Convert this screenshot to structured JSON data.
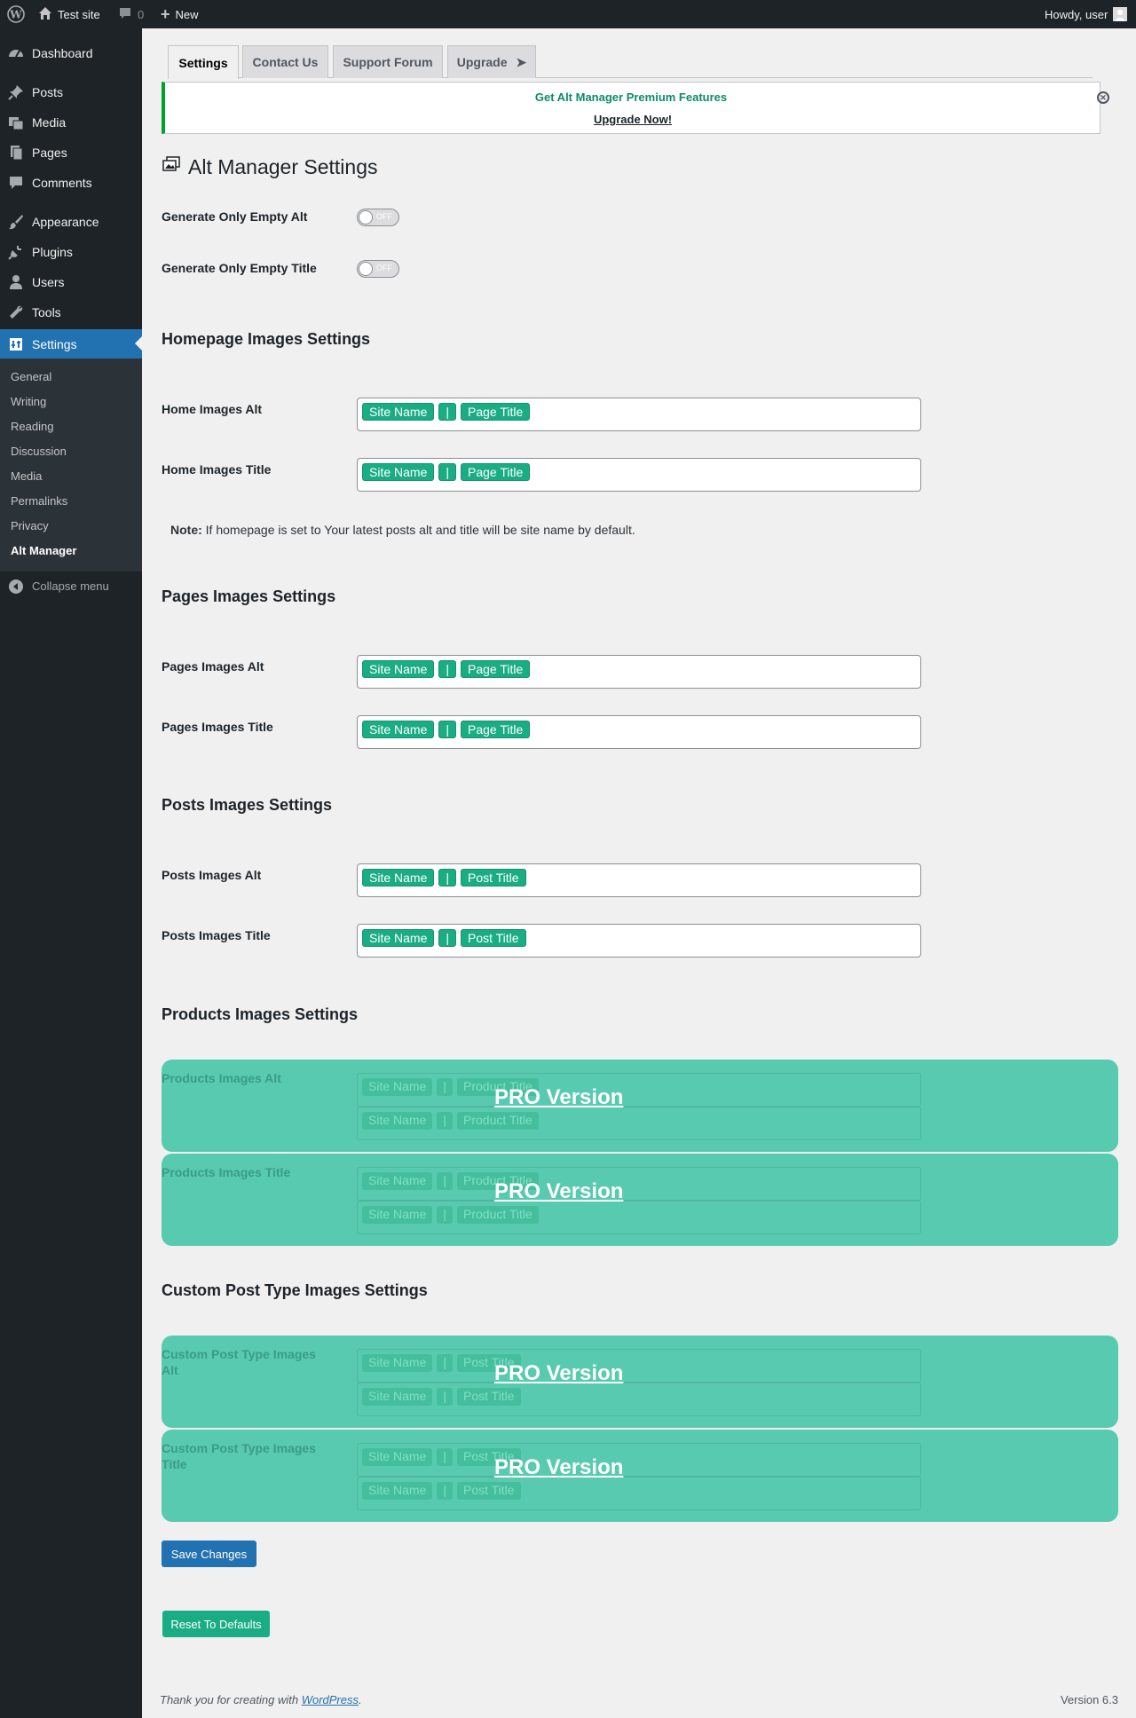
{
  "adminbar": {
    "site_name": "Test site",
    "comments_count": "0",
    "new_label": "New",
    "howdy": "Howdy, user"
  },
  "sidebar": {
    "items": [
      {
        "label": "Dashboard",
        "icon": "dashboard-icon"
      },
      {
        "label": "Posts",
        "icon": "pin-icon"
      },
      {
        "label": "Media",
        "icon": "media-icon"
      },
      {
        "label": "Pages",
        "icon": "pages-icon"
      },
      {
        "label": "Comments",
        "icon": "comment-icon"
      },
      {
        "label": "Appearance",
        "icon": "brush-icon"
      },
      {
        "label": "Plugins",
        "icon": "plug-icon"
      },
      {
        "label": "Users",
        "icon": "user-icon"
      },
      {
        "label": "Tools",
        "icon": "wrench-icon"
      },
      {
        "label": "Settings",
        "icon": "settings-icon"
      }
    ],
    "submenu": [
      "General",
      "Writing",
      "Reading",
      "Discussion",
      "Media",
      "Permalinks",
      "Privacy",
      "Alt Manager"
    ],
    "collapse": "Collapse menu"
  },
  "tabs": [
    "Settings",
    "Contact Us",
    "Support Forum",
    "Upgrade"
  ],
  "notice": {
    "title": "Get Alt Manager Premium Features",
    "link": "Upgrade Now!"
  },
  "page_title": "Alt Manager Settings",
  "toggles": {
    "empty_alt_label": "Generate Only Empty Alt",
    "empty_title_label": "Generate Only Empty Title",
    "state": "OFF"
  },
  "sections": {
    "homepage": "Homepage Images Settings",
    "pages": "Pages Images Settings",
    "posts": "Posts Images Settings",
    "products": "Products Images Settings",
    "cpt": "Custom Post Type Images Settings"
  },
  "fields": {
    "home_alt": "Home Images Alt",
    "home_title": "Home Images Title",
    "pages_alt": "Pages Images Alt",
    "pages_title": "Pages Images Title",
    "posts_alt": "Posts Images Alt",
    "posts_title": "Posts Images Title",
    "products_alt": "Products Images Alt",
    "products_title": "Products Images Title",
    "cpt_alt": "Custom Post Type Images Alt",
    "cpt_title": "Custom Post Type Images Title"
  },
  "tags": {
    "site_name": "Site Name",
    "separator": "|",
    "page_title": "Page Title",
    "post_title": "Post Title",
    "product_title": "Product Title"
  },
  "note": {
    "label": "Note:",
    "text": " If homepage is set to Your latest posts alt and title will be site name by default."
  },
  "pro_label": "PRO Version",
  "buttons": {
    "save": "Save Changes",
    "reset": "Reset To Defaults"
  },
  "footer": {
    "text": "Thank you for creating with ",
    "link": "WordPress",
    "end": ".",
    "version": "Version 6.3"
  },
  "colors": {
    "accent": "#2271b1",
    "tag": "#1aad84",
    "pro_overlay": "#58cab0",
    "sidebar": "#1d2327"
  }
}
